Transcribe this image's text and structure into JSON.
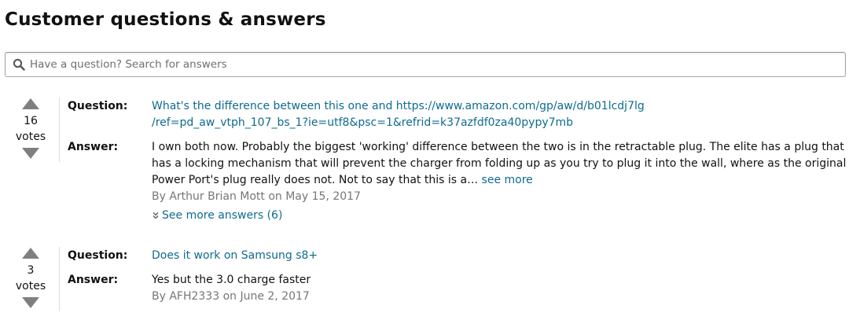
{
  "heading": "Customer questions & answers",
  "search": {
    "placeholder": "Have a question? Search for answers",
    "icon": "search-icon"
  },
  "labels": {
    "question": "Question:",
    "answer": "Answer:"
  },
  "items": [
    {
      "votes": "16",
      "votes_label": "votes",
      "question": "What's the difference between this one and https://www.amazon.com/gp/aw/d/b01lcdj7lg /ref=pd_aw_vtph_107_bs_1?ie=utf8&psc=1&refrid=k37azfdf0za40pypy7mb",
      "answer": "I own both now. Probably the biggest 'working' difference between the two is in the retractable plug. The elite has a plug that has a locking mechanism that will prevent the charger from folding up as you try to plug it into the wall, where as the original Power Port's plug really does not. Not to say that this is a…",
      "see_more": "see more",
      "byline": "By Arthur Brian Mott on May 15, 2017",
      "see_more_answers": "See more answers (6)"
    },
    {
      "votes": "3",
      "votes_label": "votes",
      "question": "Does it work on Samsung s8+",
      "answer": "Yes but the 3.0 charge faster",
      "byline": "By AFH2333 on June 2, 2017"
    }
  ],
  "colors": {
    "link": "#0f6b8e",
    "byline": "#767676",
    "arrow": "#7f7f7f"
  }
}
